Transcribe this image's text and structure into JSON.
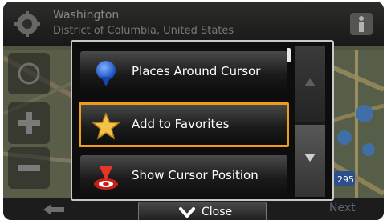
{
  "location": {
    "city": "Washington",
    "region": "District of Columbia, United States"
  },
  "menu": {
    "items": [
      {
        "label": "Places Around Cursor",
        "icon": "places-pin-icon"
      },
      {
        "label": "Add to Favorites",
        "icon": "favorites-star-icon"
      },
      {
        "label": "Show Cursor Position",
        "icon": "cursor-position-icon"
      }
    ],
    "highlighted_index": 1,
    "close_label": "Close"
  },
  "map": {
    "labels": [
      "295"
    ]
  },
  "bottom": {
    "next_label": "Next"
  },
  "colors": {
    "highlight": "#f29a1c",
    "menu_bg": "#0d0d0d",
    "topbar_bg": "#1a1a1a"
  }
}
